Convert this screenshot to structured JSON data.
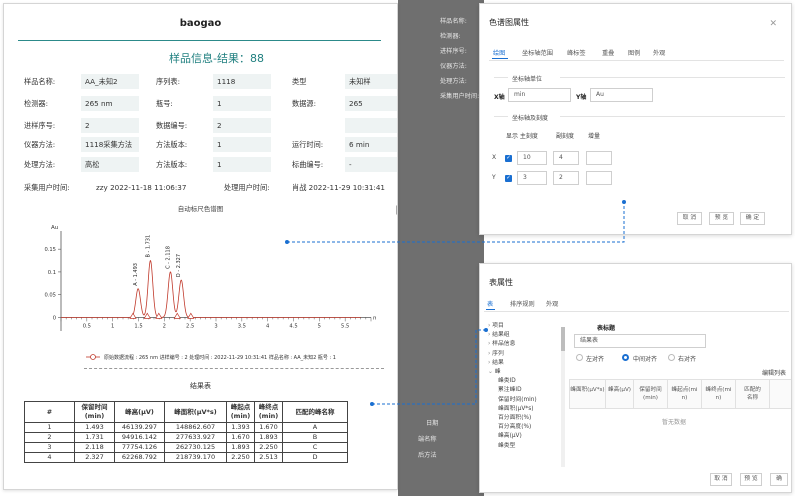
{
  "report": {
    "title": "baogao",
    "sample_heading": "样品信息-结果：88",
    "rows": [
      [
        [
          "样品名称:",
          "AA_未知2"
        ],
        [
          "序列表:",
          "1118"
        ],
        [
          "类型",
          "未知样"
        ]
      ],
      [
        [
          "检测器:",
          "265 nm"
        ],
        [
          "瓶号:",
          "1"
        ],
        [
          "数据源:",
          "265"
        ]
      ],
      [
        [
          "进样序号:",
          "2"
        ],
        [
          "数据编号:",
          "2"
        ],
        [
          "",
          ""
        ]
      ],
      [
        [
          "仪器方法:",
          "1118采集方法"
        ],
        [
          "方法版本:",
          "1"
        ],
        [
          "运行时间:",
          "6 min"
        ]
      ],
      [
        [
          "处理方法:",
          "高松"
        ],
        [
          "方法版本:",
          "1"
        ],
        [
          "标曲编号:",
          "-"
        ]
      ]
    ],
    "acq_label": "采集用户时间:",
    "acq_value": "zzy 2022-11-18 11:06:37",
    "proc_label": "处理用户时间:",
    "proc_value": "肖战 2022-11-29 10:31:41",
    "chrom_title": "自动标尺色谱图",
    "legend_text": "原始数据流程 : 265 nm 进样编号 : 2 处理时间 : 2022-11-29 10:31:41 样品名称 : AA_未知2 瓶号 : 1",
    "table_title": "结果表",
    "table_headers": [
      "#",
      "保留时间\n(min)",
      "峰高(µV)",
      "峰面积(µV*s)",
      "峰起点\n(min)",
      "峰终点\n(min)",
      "匹配的峰名称"
    ],
    "table_rows": [
      [
        "1",
        "1.493",
        "46139.297",
        "148862.607",
        "1.393",
        "1.670",
        "A"
      ],
      [
        "2",
        "1.731",
        "94916.142",
        "277633.927",
        "1.670",
        "1.893",
        "B"
      ],
      [
        "3",
        "2.118",
        "77754.126",
        "262730.125",
        "1.893",
        "2.250",
        "C"
      ],
      [
        "4",
        "2.327",
        "62268.792",
        "218739.170",
        "2.250",
        "2.513",
        "D"
      ]
    ]
  },
  "chart_data": {
    "type": "line",
    "ylabel": "Au",
    "xlabel": "min",
    "xlim": [
      0,
      6
    ],
    "ylim": [
      -0.03,
      0.19
    ],
    "x_ticks": [
      "0.5",
      "1",
      "1.5",
      "2",
      "2.5",
      "3",
      "3.5",
      "4",
      "4.5",
      "5",
      "5.5"
    ],
    "y_ticks": [
      "0.15",
      "0.1",
      "0.05",
      "0"
    ],
    "peaks": [
      {
        "label": "A - 1.493",
        "rt": 1.493,
        "height": 0.063,
        "width": 0.045
      },
      {
        "label": "B - 1.731",
        "rt": 1.731,
        "height": 0.125,
        "width": 0.045
      },
      {
        "label": "C - 2.118",
        "rt": 2.118,
        "height": 0.1,
        "width": 0.045
      },
      {
        "label": "D - 2.327",
        "rt": 2.327,
        "height": 0.082,
        "width": 0.045
      }
    ],
    "markers_x": [
      1.393,
      1.67,
      1.893,
      2.25,
      2.513
    ],
    "colors": {
      "trace": "#c0392b",
      "axis": "#555555"
    }
  },
  "bg_labels": [
    "样品名称:",
    "检测器:",
    "进样序号:",
    "仪器方法:",
    "处理方法:",
    "采集用户时间:",
    "日期",
    "端名称",
    "后方法"
  ],
  "dialog1": {
    "title": "色谱图属性",
    "tabs": [
      "绘图",
      "坐标轴范围",
      "峰标签",
      "重叠",
      "图例",
      "外观"
    ],
    "section1": "坐标轴单位",
    "x_label": "X轴",
    "x_value": "min",
    "y_label": "Y轴",
    "y_value": "Au",
    "section2": "坐标轴及刻度",
    "col_show_major": "显示 主刻度",
    "col_minor": "副刻度",
    "col_incr": "增量",
    "x_axis": "X",
    "y_axis": "Y",
    "x_major": "10",
    "x_minor": "4",
    "y_major": "3",
    "y_minor": "2",
    "buttons": [
      "取 消",
      "预 览",
      "确 定"
    ]
  },
  "dialog2": {
    "title": "表属性",
    "tabs": [
      "表",
      "排序规则",
      "外观"
    ],
    "tree": [
      "项目",
      "结果组",
      "样品信息",
      "序列",
      "结果",
      "峰",
      "峰类ID",
      "累注峰ID",
      "保留时间(min)",
      "峰面积(µV*s)",
      "百分面积(%)",
      "百分高度(%)",
      "峰高(µV)",
      "峰类型"
    ],
    "table_title_label": "表标题",
    "table_title_value": "结果表",
    "align": [
      "左对齐",
      "中间对齐",
      "右对齐"
    ],
    "edit_col": "编辑列表",
    "grid_headers": [
      "峰面积(µV*s)",
      "峰高(µV)",
      "保留时间\n(min)",
      "峰起点(mi\nn)",
      "峰终点(mi\nn)",
      "匹配的\n名称"
    ],
    "empty": "暂无数据",
    "buttons": [
      "取 消",
      "预 览",
      "确"
    ]
  }
}
